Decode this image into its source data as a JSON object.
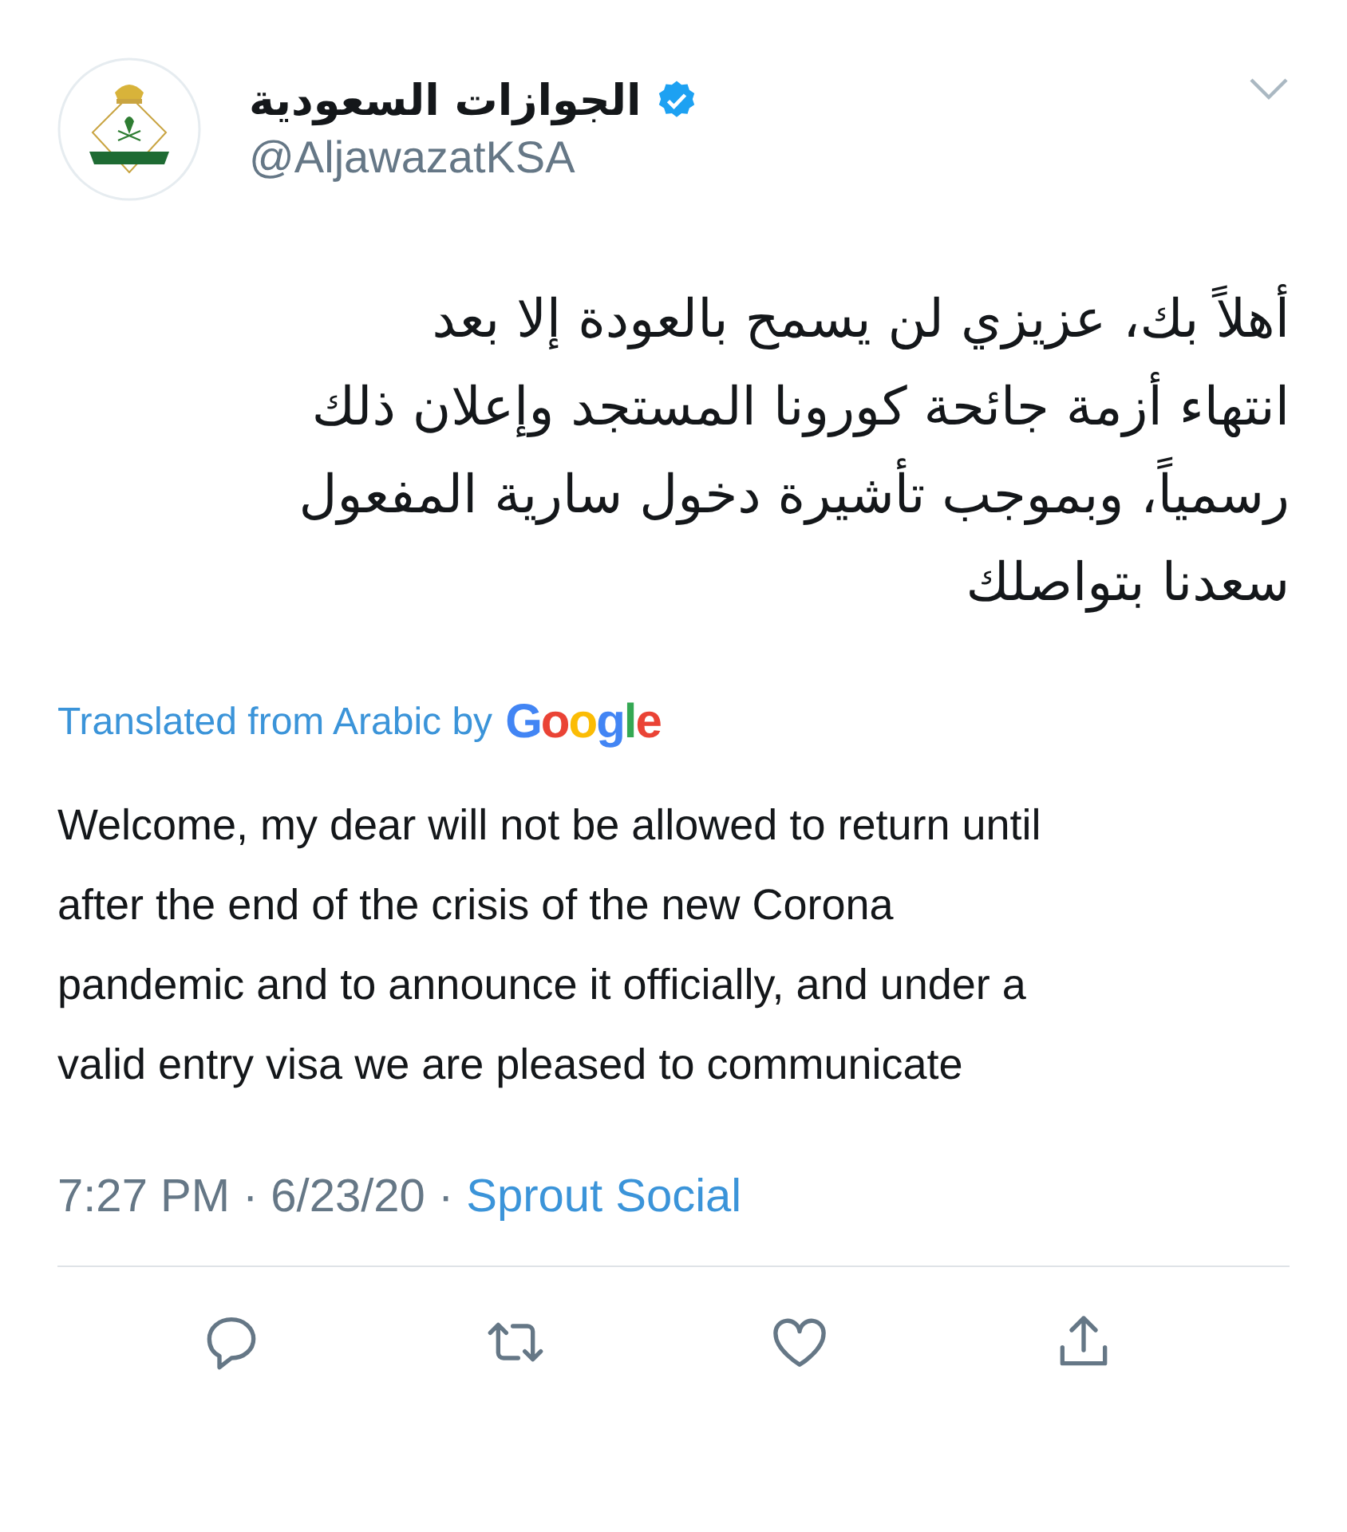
{
  "author": {
    "name": "الجوازات السعودية",
    "verified": true,
    "handle": "@AljawazatKSA"
  },
  "tweet_lines": [
    "أهلاً بك، عزيزي لن يسمح بالعودة إلا بعد",
    "انتهاء أزمة جائحة كورونا المستجد وإعلان ذلك",
    "رسمياً، وبموجب تأشيرة دخول سارية المفعول",
    "سعدنا بتواصلك"
  ],
  "translation": {
    "label": "Translated from Arabic by",
    "brand": "Google",
    "lines": [
      "Welcome, my dear will not be allowed to return until",
      "after the end of the crisis of the new Corona",
      "pandemic and to announce it officially, and under a",
      "valid entry visa we are pleased to communicate"
    ]
  },
  "meta": {
    "time": "7:27 PM",
    "date": "6/23/20",
    "separator": "·",
    "source": "Sprout Social"
  },
  "actions": [
    {
      "kind": "reply"
    },
    {
      "kind": "retweet"
    },
    {
      "kind": "like"
    },
    {
      "kind": "share"
    }
  ]
}
